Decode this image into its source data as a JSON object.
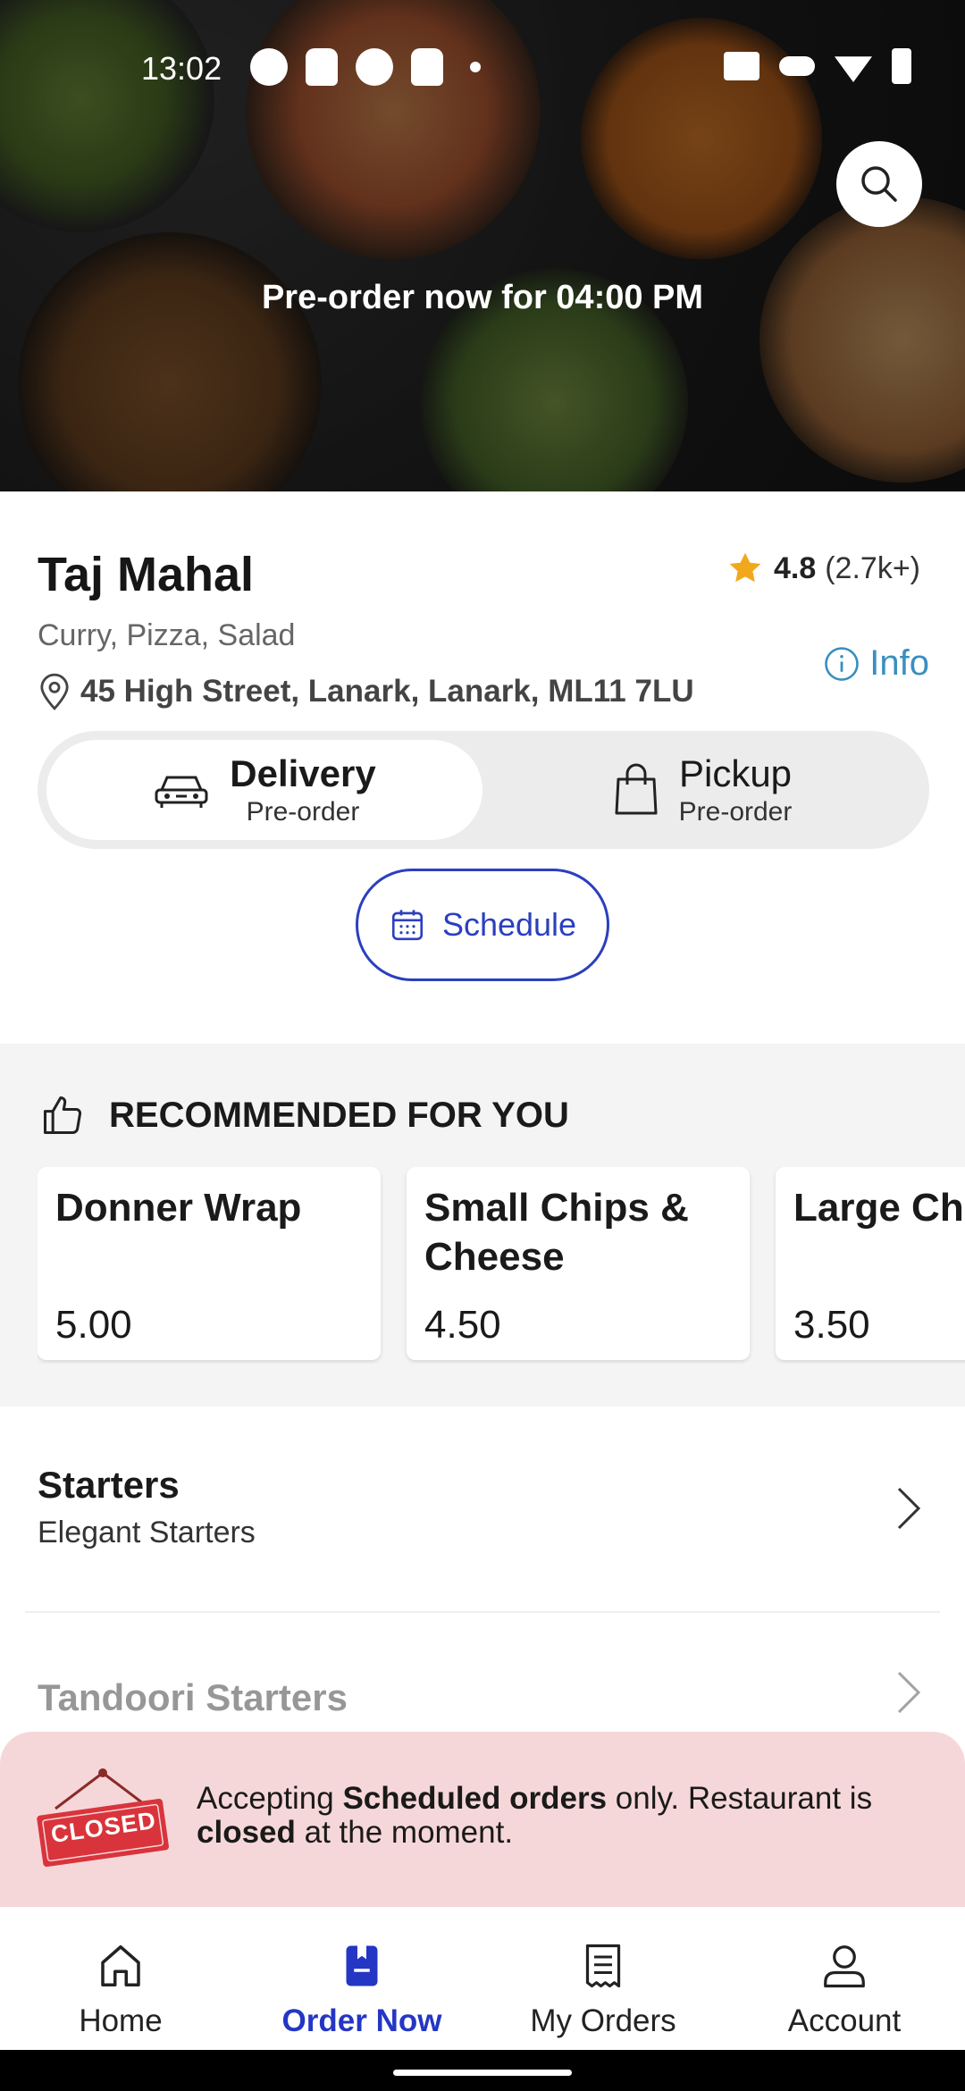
{
  "status_bar": {
    "time": "13:02"
  },
  "hero": {
    "preorder_text": "Pre-order now for 04:00 PM"
  },
  "restaurant": {
    "name": "Taj Mahal",
    "rating": "4.8",
    "rating_count": "(2.7k+)",
    "cuisines": "Curry, Pizza, Salad",
    "address": "45 High Street, Lanark, Lanark, ML11 7LU",
    "info_label": "Info"
  },
  "order_mode": {
    "delivery": {
      "title": "Delivery",
      "sub": "Pre-order",
      "selected": true
    },
    "pickup": {
      "title": "Pickup",
      "sub": "Pre-order",
      "selected": false
    }
  },
  "schedule_label": "Schedule",
  "recommended": {
    "title": "RECOMMENDED FOR YOU",
    "items": [
      {
        "name": "Donner Wrap",
        "price": "5.00"
      },
      {
        "name": "Small Chips & Cheese",
        "price": "4.50"
      },
      {
        "name": "Large Chi",
        "price": "3.50"
      }
    ]
  },
  "categories": [
    {
      "title": "Starters",
      "subtitle": "Elegant Starters"
    },
    {
      "title": "Tandoori Starters",
      "subtitle": ""
    }
  ],
  "closed_banner": {
    "sign_text": "CLOSED",
    "msg_part1": "Accepting ",
    "msg_bold1": "Scheduled orders",
    "msg_part2": " only. Restaurant is ",
    "msg_bold2": "closed",
    "msg_part3": " at the moment."
  },
  "bottom_nav": [
    {
      "label": "Home",
      "icon": "home-icon",
      "active": false
    },
    {
      "label": "Order Now",
      "icon": "order-now-icon",
      "active": true
    },
    {
      "label": "My Orders",
      "icon": "receipt-icon",
      "active": false
    },
    {
      "label": "Account",
      "icon": "person-icon",
      "active": false
    }
  ],
  "colors": {
    "accent_blue": "#2436c4",
    "info_blue": "#3a8fbf",
    "star": "#f2a81d",
    "closed_banner_bg": "#f6d7d9",
    "closed_sign_red": "#d9343c"
  }
}
